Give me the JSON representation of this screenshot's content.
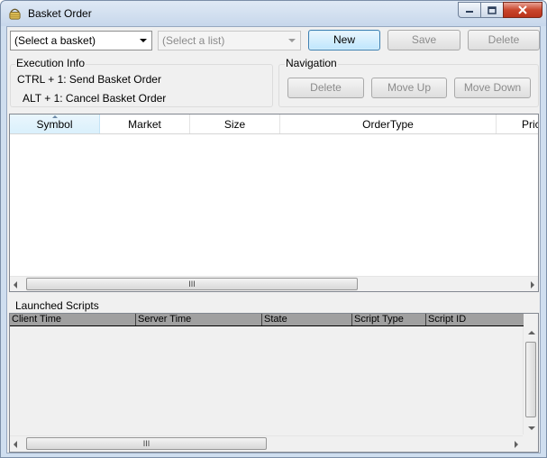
{
  "window": {
    "title": "Basket Order"
  },
  "toolbar": {
    "basket_select": "(Select a basket)",
    "list_select": "(Select a list)",
    "new_label": "New",
    "save_label": "Save",
    "delete_label": "Delete"
  },
  "execution_info": {
    "label": "Execution Info",
    "lines": [
      "CTRL + 1: Send Basket Order",
      "ALT + 1: Cancel Basket Order"
    ]
  },
  "navigation": {
    "label": "Navigation",
    "delete_label": "Delete",
    "move_up_label": "Move Up",
    "move_down_label": "Move Down"
  },
  "orders_grid": {
    "columns": [
      "Symbol",
      "Market",
      "Size",
      "OrderType",
      "Pric"
    ],
    "sorted_column": "Symbol",
    "scroll_thumb": "III"
  },
  "launched_scripts": {
    "label": "Launched Scripts",
    "columns": [
      "Client Time",
      "Server Time",
      "State",
      "Script Type",
      "Script ID"
    ],
    "scroll_thumb": "III"
  }
}
